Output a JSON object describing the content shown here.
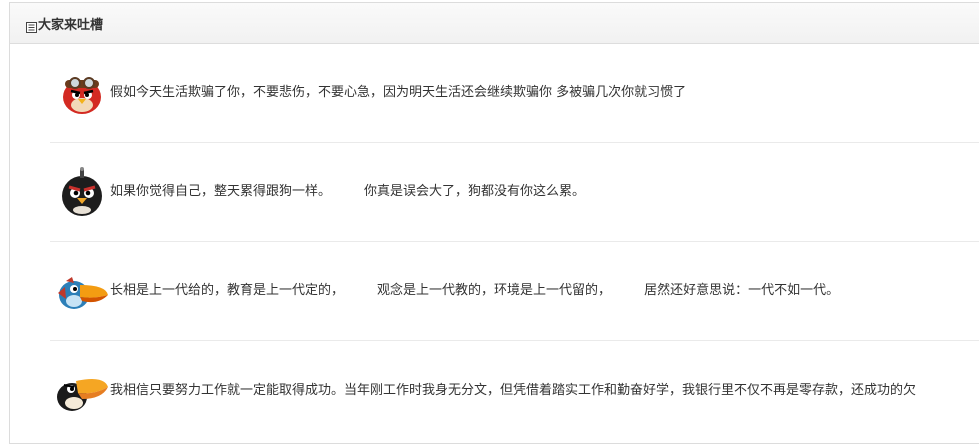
{
  "panel": {
    "title": "大家来吐槽"
  },
  "items": [
    {
      "avatar": "red-angry-bird-aviator-icon",
      "text": "假如今天生活欺骗了你，不要悲伤，不要心急，因为明天生活还会继续欺骗你 多被骗几次你就习惯了"
    },
    {
      "avatar": "black-bomb-bird-icon",
      "text": "如果你觉得自己，整天累得跟狗一样。        你真是误会大了，狗都没有你这么累。"
    },
    {
      "avatar": "blue-toucan-bird-icon",
      "text": "长相是上一代给的，教育是上一代定的，        观念是上一代教的，环境是上一代留的，        居然还好意思说：一代不如一代。"
    },
    {
      "avatar": "orange-beak-toucan-bird-icon",
      "text": "我相信只要努力工作就一定能取得成功。当年刚工作时我身无分文，但凭借着踏实工作和勤奋好学，我银行里不仅不再是零存款，还成功的欠"
    }
  ]
}
